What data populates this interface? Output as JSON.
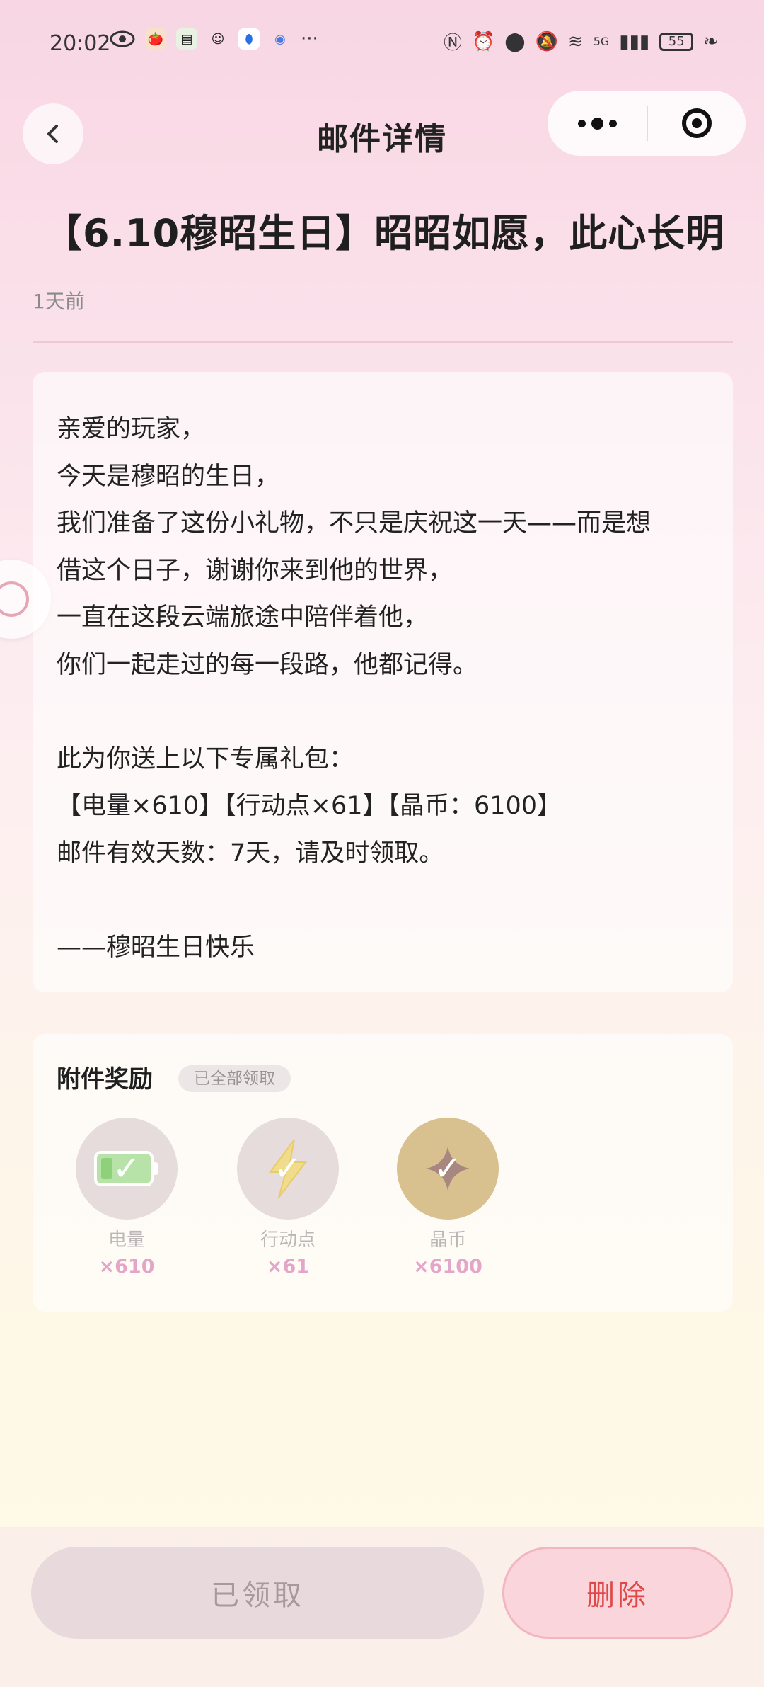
{
  "status_bar": {
    "time": "20:02",
    "network": "5G",
    "battery": "55"
  },
  "nav": {
    "title": "邮件详情"
  },
  "mail": {
    "title": "【6.10穆昭生日】昭昭如愿，此心长明",
    "time": "1天前",
    "body_lines": [
      "亲爱的玩家，",
      "今天是穆昭的生日，",
      "我们准备了这份小礼物，不只是庆祝这一天——而是想",
      "借这个日子，谢谢你来到他的世界，",
      "一直在这段云端旅途中陪伴着他，",
      "你们一起走过的每一段路，他都记得。",
      "",
      "此为你送上以下专属礼包：",
      "【电量×610】【行动点×61】【晶币：6100】",
      "邮件有效天数：7天，请及时领取。",
      "",
      "——穆昭生日快乐"
    ]
  },
  "attachments": {
    "title": "附件奖励",
    "badge": "已全部领取",
    "items": [
      {
        "name": "电量",
        "qty": "×610",
        "icon": "battery-icon",
        "color": "#e6dcdc"
      },
      {
        "name": "行动点",
        "qty": "×61",
        "icon": "lightning-icon",
        "color": "#e6dcdc"
      },
      {
        "name": "晶币",
        "qty": "×6100",
        "icon": "crystal-coin-icon",
        "color": "#d9c08f"
      }
    ]
  },
  "actions": {
    "claimed": "已领取",
    "delete": "删除"
  },
  "colors": {
    "accent_pink": "#e3a6c9",
    "delete_red": "#e04848"
  }
}
